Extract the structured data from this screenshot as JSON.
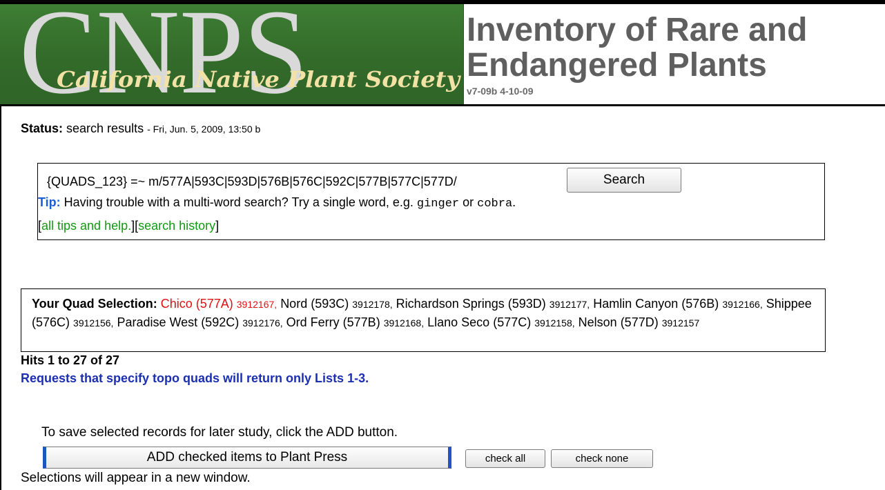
{
  "header": {
    "logo_letters": "CNPS",
    "logo_script": "California Native Plant Society",
    "title_line1": "Inventory of Rare and",
    "title_line2": "Endangered Plants",
    "version": "v7-09b 4-10-09"
  },
  "status": {
    "label": "Status:",
    "value": "search results",
    "timestamp": "- Fri, Jun. 5, 2009, 13:50 b"
  },
  "search": {
    "query": "{QUADS_123} =~ m/577A|593C|593D|576B|576C|592C|577B|577C|577D/",
    "button_label": "Search",
    "tip_label": "Tip:",
    "tip_text1": " Having trouble with a multi-word search? Try a single word, e.g. ",
    "tip_word1": "ginger",
    "tip_or": " or ",
    "tip_word2": "cobra",
    "tip_end": ".",
    "link_open": "[",
    "link_all_tips": "all tips and help.",
    "link_mid": "][",
    "link_history": "search history",
    "link_close": "]"
  },
  "quads": {
    "label": "Your Quad Selection:",
    "items": [
      {
        "name": "Chico (577A)",
        "code": "3912167,"
      },
      {
        "name": "Nord (593C)",
        "code": "3912178,"
      },
      {
        "name": "Richardson Springs (593D)",
        "code": "3912177,"
      },
      {
        "name": "Hamlin Canyon (576B)",
        "code": "3912166,"
      },
      {
        "name": "Shippee (576C)",
        "code": "3912156,"
      },
      {
        "name": "Paradise West (592C)",
        "code": "3912176,"
      },
      {
        "name": "Ord Ferry (577B)",
        "code": "3912168,"
      },
      {
        "name": "Llano Seco (577C)",
        "code": "3912158,"
      },
      {
        "name": "Nelson (577D)",
        "code": "3912157"
      }
    ]
  },
  "results": {
    "hits": "Hits 1 to 27 of 27",
    "note": "Requests that specify topo quads will return only Lists 1-3."
  },
  "plant_press": {
    "info": "To save selected records for later study, click the ADD button.",
    "add_label": "ADD checked items to Plant Press",
    "check_all_label": "check all",
    "check_none_label": "check none",
    "footer": "Selections will appear in a new window."
  },
  "colors": {
    "logo_green": "#3a7630",
    "tip_blue": "#1a5ed8",
    "link_green": "#119911",
    "highlight_red": "#e11010",
    "note_blue": "#1c2fb0"
  }
}
